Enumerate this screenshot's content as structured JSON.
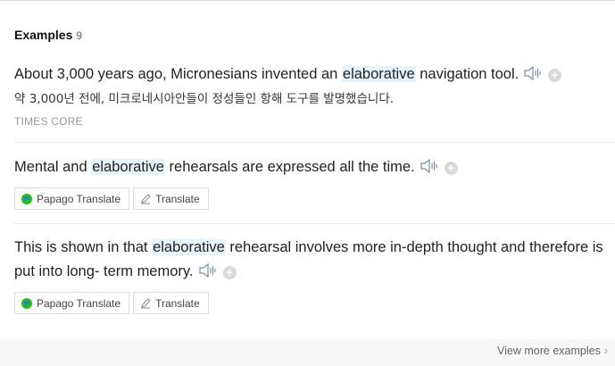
{
  "section": {
    "title": "Examples",
    "count": "9"
  },
  "examples": [
    {
      "pre": "About 3,000 years ago, Micronesians invented an ",
      "highlight": "elaborative",
      "post": " navigation tool.",
      "translation": "약 3,000년 전에, 미크로네시아안들이 정성들인 항해 도구를 발명했습니다.",
      "source": "TIMES CORE"
    },
    {
      "pre": "Mental and ",
      "highlight": "elaborative",
      "post": " rehearsals are expressed all the time.",
      "buttons": {
        "papago": "Papago Translate",
        "translate": "Translate"
      }
    },
    {
      "pre": "This is shown in that ",
      "highlight": "elaborative",
      "post": " rehearsal involves more in-depth thought and therefore is put into long- term memory.",
      "buttons": {
        "papago": "Papago Translate",
        "translate": "Translate"
      }
    }
  ],
  "footer": {
    "more_label": "View more examples"
  },
  "colors": {
    "highlight": "#e6f3fb",
    "papago_green": "#1ec800",
    "papago_blue": "#2b7de9"
  },
  "icons": {
    "speaker": "speaker-icon",
    "add": "plus-icon",
    "papago": "papago-logo-icon",
    "translate": "pencil-icon",
    "more": "chevron-right-icon"
  }
}
